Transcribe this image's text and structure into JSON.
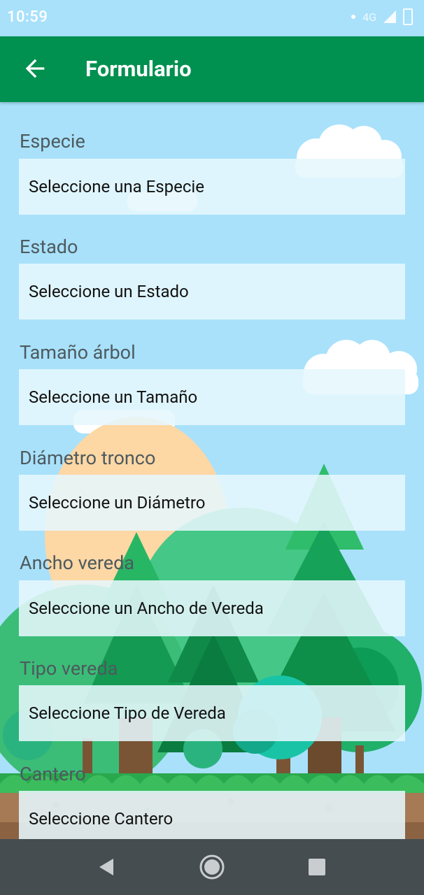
{
  "status_bar": {
    "time": "10:59",
    "network": "4G"
  },
  "app_bar": {
    "title": "Formulario",
    "back_icon": "arrow-back-icon"
  },
  "fields": [
    {
      "label": "Especie",
      "placeholder": "Seleccione una Especie"
    },
    {
      "label": "Estado",
      "placeholder": "Seleccione un Estado"
    },
    {
      "label": "Tamaño árbol",
      "placeholder": "Seleccione un Tamaño"
    },
    {
      "label": "Diámetro tronco",
      "placeholder": "Seleccione un Diámetro"
    },
    {
      "label": "Ancho vereda",
      "placeholder": "Seleccione un Ancho de Vereda"
    },
    {
      "label": "Tipo vereda",
      "placeholder": "Seleccione Tipo de Vereda"
    },
    {
      "label": "Cantero",
      "placeholder": "Seleccione Cantero"
    }
  ],
  "nav_bar": {
    "back": "nav-back-icon",
    "home": "nav-home-icon",
    "recents": "nav-recents-icon"
  },
  "colors": {
    "app_bar": "#00904f",
    "sky": "#a9e1fb",
    "nav_bar": "#454d50"
  }
}
